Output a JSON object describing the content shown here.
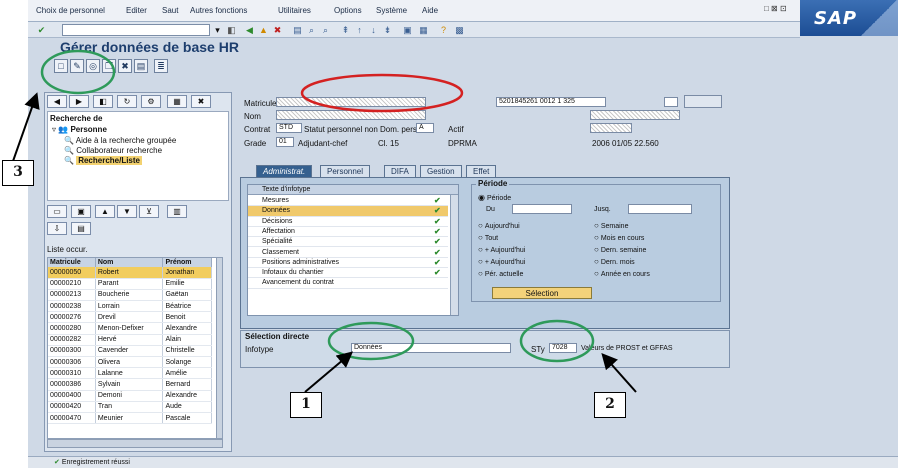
{
  "menubar": {
    "items": [
      "Choix de personnel",
      "Editer",
      "Saut",
      "Autres fonctions",
      "Utilitaires",
      "Options",
      "Système",
      "Aide"
    ],
    "window_controls": "□ ⊠ ⊡"
  },
  "brand": {
    "logo": "SAP"
  },
  "page": {
    "title": "Gérer données de base HR"
  },
  "icons": {
    "enter": "check-icon",
    "save": "save-icon",
    "back": "back-icon",
    "exit": "exit-icon",
    "cancel": "cancel-icon",
    "print": "print-icon",
    "find": "find-icon",
    "help": "help-icon",
    "create": "create-icon",
    "change": "change-icon",
    "display": "display-icon",
    "copy": "copy-icon",
    "delete": "delete-icon",
    "overview": "overview-icon"
  },
  "left_panel": {
    "tree_title": "Recherche de",
    "tree_root": "Personne",
    "tree_items": [
      "Aide à la recherche groupée",
      "Collaborateur recherche",
      "Recherche/Liste"
    ],
    "hitlist_title": "Liste occur.",
    "columns": [
      "Matricule",
      "Nom",
      "Prénom"
    ],
    "rows": [
      [
        "00000050",
        "Robert",
        "Jonathan"
      ],
      [
        "00000210",
        "Parant",
        "Emilie"
      ],
      [
        "00000213",
        "Boucherie",
        "Gaëtan"
      ],
      [
        "00000238",
        "Lorrain",
        "Béatrice"
      ],
      [
        "00000276",
        "Drevil",
        "Benoit"
      ],
      [
        "00000280",
        "Menon-Defixer",
        "Alexandre"
      ],
      [
        "00000282",
        "Hervé",
        "Alain"
      ],
      [
        "00000300",
        "Cavender",
        "Christelle"
      ],
      [
        "00000306",
        "Olivera",
        "Solange"
      ],
      [
        "00000310",
        "Lalanne",
        "Amélie"
      ],
      [
        "00000386",
        "Sylvain",
        "Bernard"
      ],
      [
        "00000400",
        "Demoni",
        "Alexandre"
      ],
      [
        "00000420",
        "Tran",
        "Aude"
      ],
      [
        "00000470",
        "Meunier",
        "Pascale"
      ]
    ]
  },
  "header": {
    "matricule_label": "Matricule",
    "name_label": "Nom",
    "name_value": "",
    "cadre_label": "Contrat",
    "cadre_code": "STD",
    "cadre_value": "Statut personnel non",
    "area_label": "Dom. pers.",
    "area_code": "A",
    "activity_label": "Actif",
    "grade_label": "Grade",
    "grade_code": "01",
    "grade_value": "Adjudant-chef",
    "gt_label": "Cl. 15",
    "unit_label": "DPRMA",
    "date_value": "2006 01/05 22.560",
    "identifier_value": "5201845261 0012 1 325"
  },
  "tabs": [
    "Administrat.",
    "Personnel",
    "DIFA",
    "Gestion",
    "Effet"
  ],
  "infotypes": {
    "header": "Texte d'infotype",
    "rows": [
      "Mesures",
      "Données",
      "Décisions",
      "Affectation",
      "Spécialité",
      "Classement",
      "Positions administratives",
      "Infotaux du chantier",
      "Avancement du contrat"
    ]
  },
  "period": {
    "title": "Période",
    "period_option": "Période",
    "from_label": "Du",
    "to_label": "Jusq.",
    "options": [
      "Aujourd'hui",
      "Semaine",
      "Tout",
      "Mois en cours",
      "+ Aujourd'hui",
      "Dern. semaine",
      "+ Aujourd'hui",
      "Dern. mois",
      "Pér. actuelle",
      "Année en cours"
    ],
    "button_label": "Sélection"
  },
  "direct": {
    "title": "Sélection directe",
    "infotype_label": "Infotype",
    "infotype_value": "Données",
    "sty_label": "STy",
    "sty_value": "7028",
    "sty_text": "Valeurs de PROST et GFFAS"
  },
  "status": {
    "text": "Enregistrement réussi"
  },
  "annotations": {
    "one": "1",
    "two": "2",
    "three": "3"
  }
}
